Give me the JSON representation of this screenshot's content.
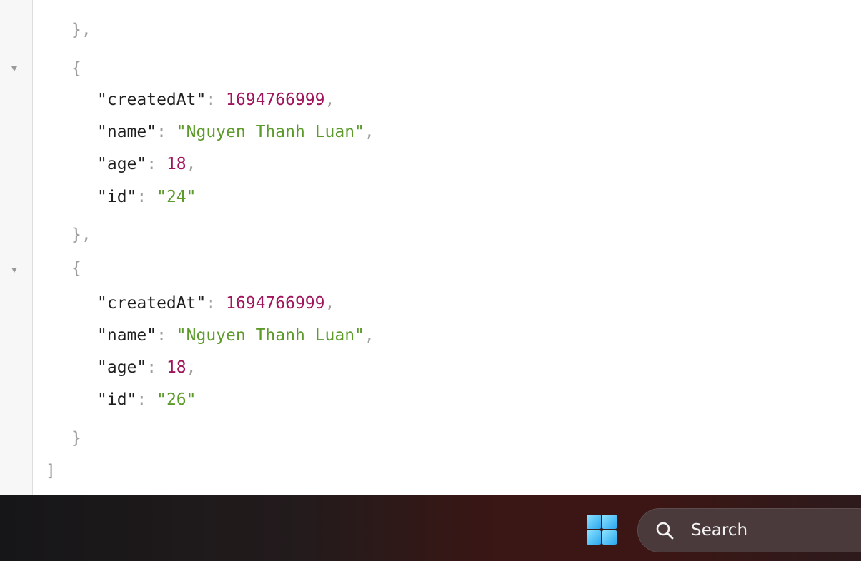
{
  "json_viewer": {
    "lines": {
      "close_obj_1": "},",
      "open_obj_1": "{",
      "obj1_createdAt_key": "\"createdAt\"",
      "obj1_createdAt_val": "1694766999",
      "obj1_name_key": "\"name\"",
      "obj1_name_val": "\"Nguyen Thanh Luan\"",
      "obj1_age_key": "\"age\"",
      "obj1_age_val": "18",
      "obj1_id_key": "\"id\"",
      "obj1_id_val": "\"24\"",
      "close_obj_2": "},",
      "open_obj_2": "{",
      "obj2_createdAt_key": "\"createdAt\"",
      "obj2_createdAt_val": "1694766999",
      "obj2_name_key": "\"name\"",
      "obj2_name_val": "\"Nguyen Thanh Luan\"",
      "obj2_age_key": "\"age\"",
      "obj2_age_val": "18",
      "obj2_id_key": "\"id\"",
      "obj2_id_val": "\"26\"",
      "close_obj_3": "}",
      "close_array": "]"
    },
    "colors": {
      "number": "#a0145c",
      "string": "#5c9a2a",
      "key": "#1f1f1f",
      "punctuation": "#9d9d9d"
    }
  },
  "taskbar": {
    "start_icon": "windows-start-icon",
    "search_icon": "search-icon",
    "search_label": "Search"
  }
}
